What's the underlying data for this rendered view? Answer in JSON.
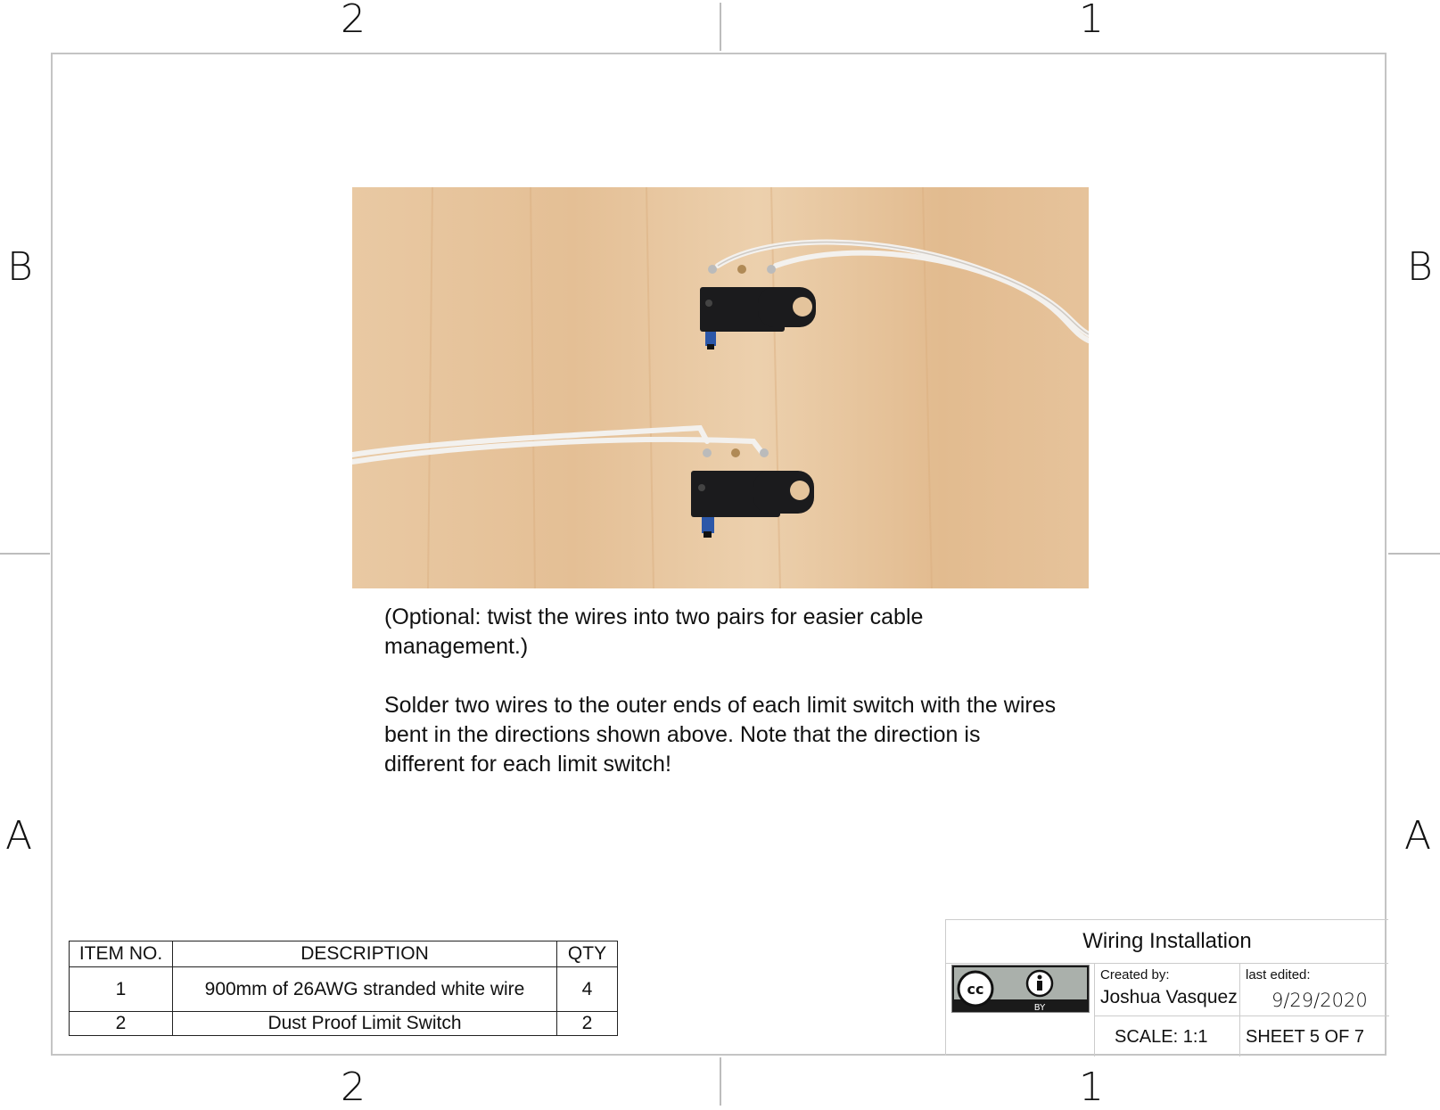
{
  "zones": {
    "top_left": "2",
    "top_right": "1",
    "bottom_left": "2",
    "bottom_right": "1",
    "left_upper": "B",
    "left_lower": "A",
    "right_upper": "B",
    "right_lower": "A"
  },
  "photo": {
    "subject": "two-limit-switches-with-soldered-wires"
  },
  "notes": {
    "optional": "(Optional: twist the wires into two pairs for easier cable\nmanagement.)",
    "instruction": "Solder two wires to the outer ends of each limit switch with the wires\nbent in the directions shown above. Note that the direction is\ndifferent for each limit switch!"
  },
  "bom": {
    "headers": [
      "ITEM NO.",
      "DESCRIPTION",
      "QTY"
    ],
    "rows": [
      {
        "item": "1",
        "description": "900mm of 26AWG stranded white wire",
        "qty": "4"
      },
      {
        "item": "2",
        "description": "Dust Proof Limit Switch",
        "qty": "2"
      }
    ]
  },
  "title_block": {
    "title": "Wiring Installation",
    "created_by_label": "Created by:",
    "author": "Joshua Vasquez",
    "last_edited_label": "last edited:",
    "date": "9/29/2020",
    "scale": "SCALE: 1:1",
    "sheet": "SHEET 5 OF 7",
    "license_icon": "cc-by-icon",
    "license_text": "BY"
  }
}
